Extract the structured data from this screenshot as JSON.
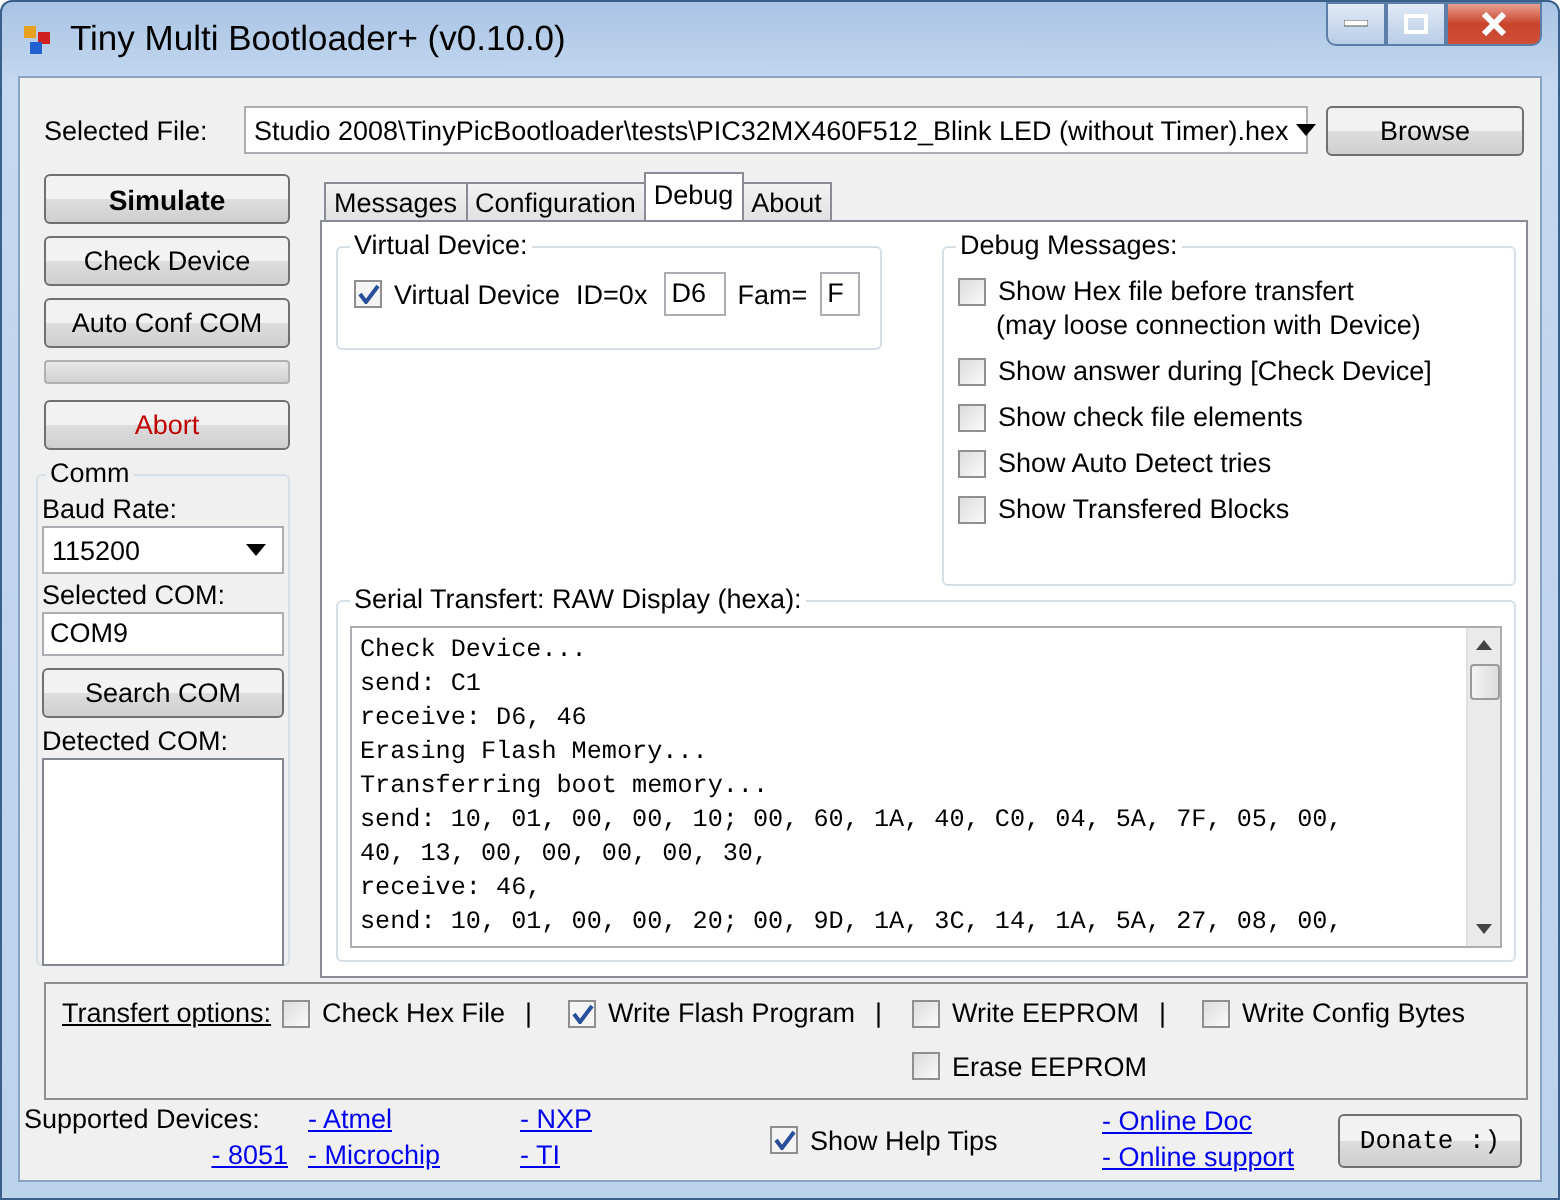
{
  "window": {
    "title": "Tiny Multi Bootloader+ (v0.10.0)"
  },
  "file_row": {
    "label": "Selected File:",
    "value": "Studio 2008\\TinyPicBootloader\\tests\\PIC32MX460F512_Blink LED (without Timer).hex",
    "button": "Browse"
  },
  "left_panel": [
    {
      "kind": "primary",
      "label": "Simulate"
    },
    {
      "kind": "button",
      "label": "Check Device"
    },
    {
      "kind": "button",
      "label": "Auto Conf COM"
    },
    {
      "kind": "progress",
      "level": 0
    },
    {
      "kind": "abort",
      "label": "Abort"
    }
  ],
  "comm": {
    "title": "Comm",
    "baud_label": "Baud Rate:",
    "baud_value": "115200",
    "com_label": "Selected COM:",
    "com_value": "COM9",
    "search_button": "Search COM",
    "detected_label": "Detected COM:"
  },
  "tabs": [
    {
      "label": "Messages",
      "selected": false
    },
    {
      "label": "Configuration",
      "selected": false
    },
    {
      "label": "Debug",
      "selected": true
    },
    {
      "label": "About",
      "selected": false
    }
  ],
  "virtual_device": {
    "title": "Virtual Device:",
    "checkbox": {
      "label": "Virtual Device",
      "checked": true
    },
    "id_label": "ID=0x",
    "id_value": "D6",
    "fam_label": "Fam=",
    "fam_value": "F"
  },
  "debug_messages": {
    "title": "Debug Messages:",
    "options": [
      {
        "label": "Show Hex file before transfert",
        "note": "(may loose connection with Device)",
        "checked": false
      },
      {
        "label": "Show answer during [Check Device]",
        "checked": false
      },
      {
        "label": "Show check file elements",
        "checked": false
      },
      {
        "label": "Show Auto Detect tries",
        "checked": false
      },
      {
        "label": "Show Transfered Blocks",
        "checked": false
      }
    ]
  },
  "serial": {
    "title": "Serial Transfert: RAW Display (hexa):",
    "lines": [
      "Check Device...",
      "send: C1",
      "receive: D6, 46",
      "Erasing Flash Memory...",
      "Transferring boot memory...",
      "send: 10, 01, 00, 00, 10; 00, 60, 1A, 40, C0, 04, 5A, 7F, 05, 00,",
      "40, 13, 00, 00, 00, 00, 30,",
      "receive: 46,",
      "send: 10, 01, 00, 00, 20; 00, 9D, 1A, 3C, 14, 1A, 5A, 27, 08, 00,"
    ]
  },
  "transfer_options": {
    "label": "Transfert options:",
    "options": [
      {
        "label": "Check Hex File",
        "checked": false,
        "separator": "|"
      },
      {
        "label": "Write Flash Program",
        "checked": true,
        "separator": "|"
      },
      {
        "label": "Write EEPROM",
        "checked": false,
        "separator": "|"
      },
      {
        "label": "Write Config Bytes",
        "checked": false
      },
      {
        "label": "Erase EEPROM",
        "checked": false
      }
    ]
  },
  "footer": {
    "supported_label": "Supported Devices:",
    "device_links": [
      "- 8051",
      "- Atmel",
      "- Microchip",
      "- NXP",
      "- TI"
    ],
    "help_tips": {
      "label": "Show Help Tips",
      "checked": true
    },
    "doc_links": [
      "- Online Doc",
      "- Online support"
    ],
    "donate": "Donate :)"
  }
}
